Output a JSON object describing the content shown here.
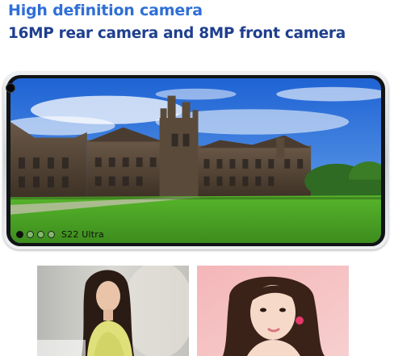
{
  "header": {
    "title": "High definition camera",
    "subtitle": "16MP rear camera and 8MP front camera"
  },
  "phone": {
    "model_label": "S22 Ultra",
    "mode_dots": [
      "filled",
      "empty",
      "empty",
      "empty"
    ]
  },
  "colors": {
    "title": "#2f6fd6",
    "subtitle": "#1f3f8f",
    "phone_frame": "#d6d9dd",
    "sky": "#2f6fd6",
    "lawn": "#56b027"
  },
  "images": {
    "phone_screen": "university-building-photo",
    "rear_sample": "woman-portrait-photo",
    "front_sample": "selfie-portrait-photo"
  }
}
